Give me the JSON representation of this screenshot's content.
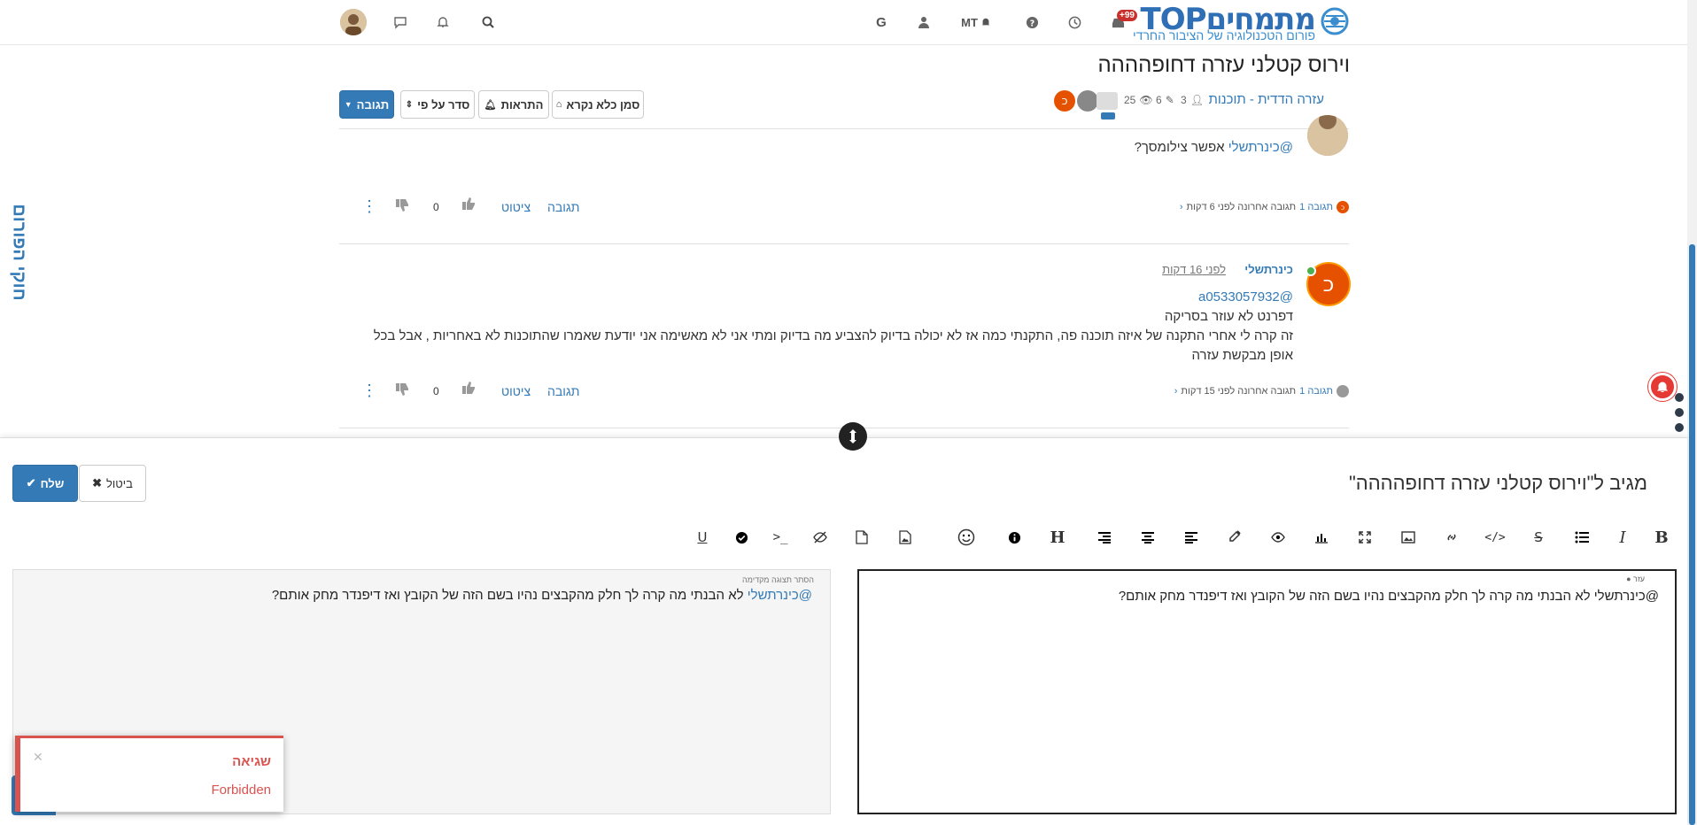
{
  "header": {
    "logo_text": "מתמחיםTOP",
    "logo_subtitle": "פורום הטכנולוגיה של הציבור החרדי",
    "user_initials": "MT",
    "chat_badge": "+99",
    "icons": [
      "search-icon",
      "bell-icon",
      "chat-icon",
      "google-icon",
      "user-icon",
      "bell-icon",
      "help-icon",
      "clock-icon",
      "inbox-icon"
    ]
  },
  "topic": {
    "title": "וירוס קטלני עזרה דחופהההה",
    "category": "עזרה הדדית - תוכנות",
    "stats": {
      "posts": "3",
      "edits": "6",
      "views": "25"
    },
    "buttons": {
      "reply": "תגובה",
      "sort": "סדר על פי",
      "notifications": "התראות",
      "mark_unread": "סמן כלא נקרא"
    }
  },
  "posts": [
    {
      "mention": "@כינרתשלי",
      "text": "אפשר צילומסך?",
      "replies_link": "תגובה 1",
      "replies_meta": "תגובה אחרונה לפני 6 דקות",
      "votes": "0",
      "reply_label": "תגובה",
      "quote_label": "ציטוט"
    },
    {
      "author": "כינרתשלי",
      "time": "לפני 16 דקות",
      "avatar_letter": "כ",
      "mention": "@a0533057932",
      "lines": [
        "דפרנט לא עוזר בסריקה",
        "זה קרה לי אחרי התקנה של איזה תוכנה פה, התקנתי כמה אז לא יכולה בדיוק להצביע מה בדיוק ומתי אני לא מאשימה אני יודעת שאמרו שהתוכנות לא באחריות , אבל בכל",
        "אופן מבקשת עזרה"
      ],
      "replies_link": "תגובה 1",
      "replies_meta": "תגובה אחרונה לפני 15 דקות",
      "votes": "0",
      "reply_label": "תגובה",
      "quote_label": "ציטוט"
    }
  ],
  "sidebar": {
    "rules_tab": "חוקי הפורום"
  },
  "composer": {
    "title": "מגיב ל\"וירוס קטלני עזרה דחופהההה\"",
    "submit": "שלח",
    "cancel": "ביטול",
    "editor_help": "עזר",
    "editor_text": "@כינרתשלי לא הבנתי מה קרה לך חלק מהקבצים נהיו בשם הזה של הקובץ ואז דיפנדר מחק אותם?",
    "preview_label": "הסתר תצוגה מקדימה",
    "preview_mention": "@כינרתשלי",
    "preview_text": " לא הבנתי מה קרה לך חלק מהקבצים נהיו בשם הזה של הקובץ ואז דיפנדר מחק אותם?",
    "toolbar": [
      "bold-icon",
      "italic-icon",
      "list-icon",
      "strikethrough-icon",
      "code-icon",
      "link-icon",
      "image-icon",
      "fullscreen-icon",
      "chart-icon",
      "eye-icon",
      "color-picker-icon",
      "align-left-icon",
      "align-center-icon",
      "align-right-icon",
      "heading-icon",
      "info-icon",
      "emoji-icon",
      "upload-image-icon",
      "file-icon",
      "spoiler-icon",
      "terminal-icon",
      "check-circle-icon",
      "underline-icon"
    ]
  },
  "toast": {
    "title": "שגיאה",
    "message": "Forbidden"
  },
  "colors": {
    "primary": "#337ab7",
    "error": "#d9534f",
    "avatar": "#e65100"
  }
}
